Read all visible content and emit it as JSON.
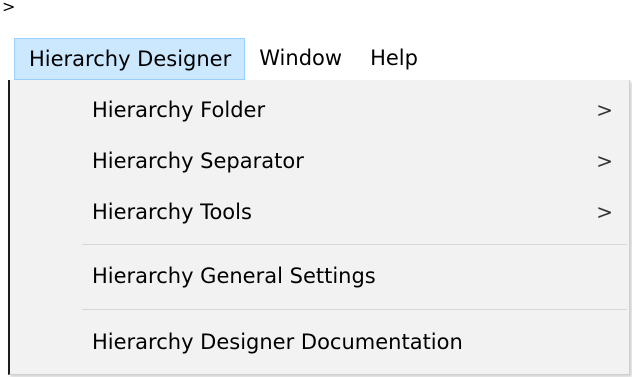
{
  "corner_glyph": ">",
  "menubar": {
    "items": [
      {
        "label": "Hierarchy Designer",
        "active": true
      },
      {
        "label": "Window",
        "active": false
      },
      {
        "label": "Help",
        "active": false
      }
    ]
  },
  "dropdown": {
    "items": [
      {
        "label": "Hierarchy Folder",
        "submenu_arrow": ">"
      },
      {
        "label": "Hierarchy Separator",
        "submenu_arrow": ">"
      },
      {
        "label": "Hierarchy Tools",
        "submenu_arrow": ">"
      },
      {
        "label": "Hierarchy General Settings"
      },
      {
        "label": "Hierarchy Designer Documentation"
      }
    ]
  },
  "colors": {
    "active_menu_bg": "#cce8ff",
    "active_menu_border": "#99d1ff",
    "dropdown_bg": "#f2f2f2",
    "separator": "#d7d7d7"
  }
}
